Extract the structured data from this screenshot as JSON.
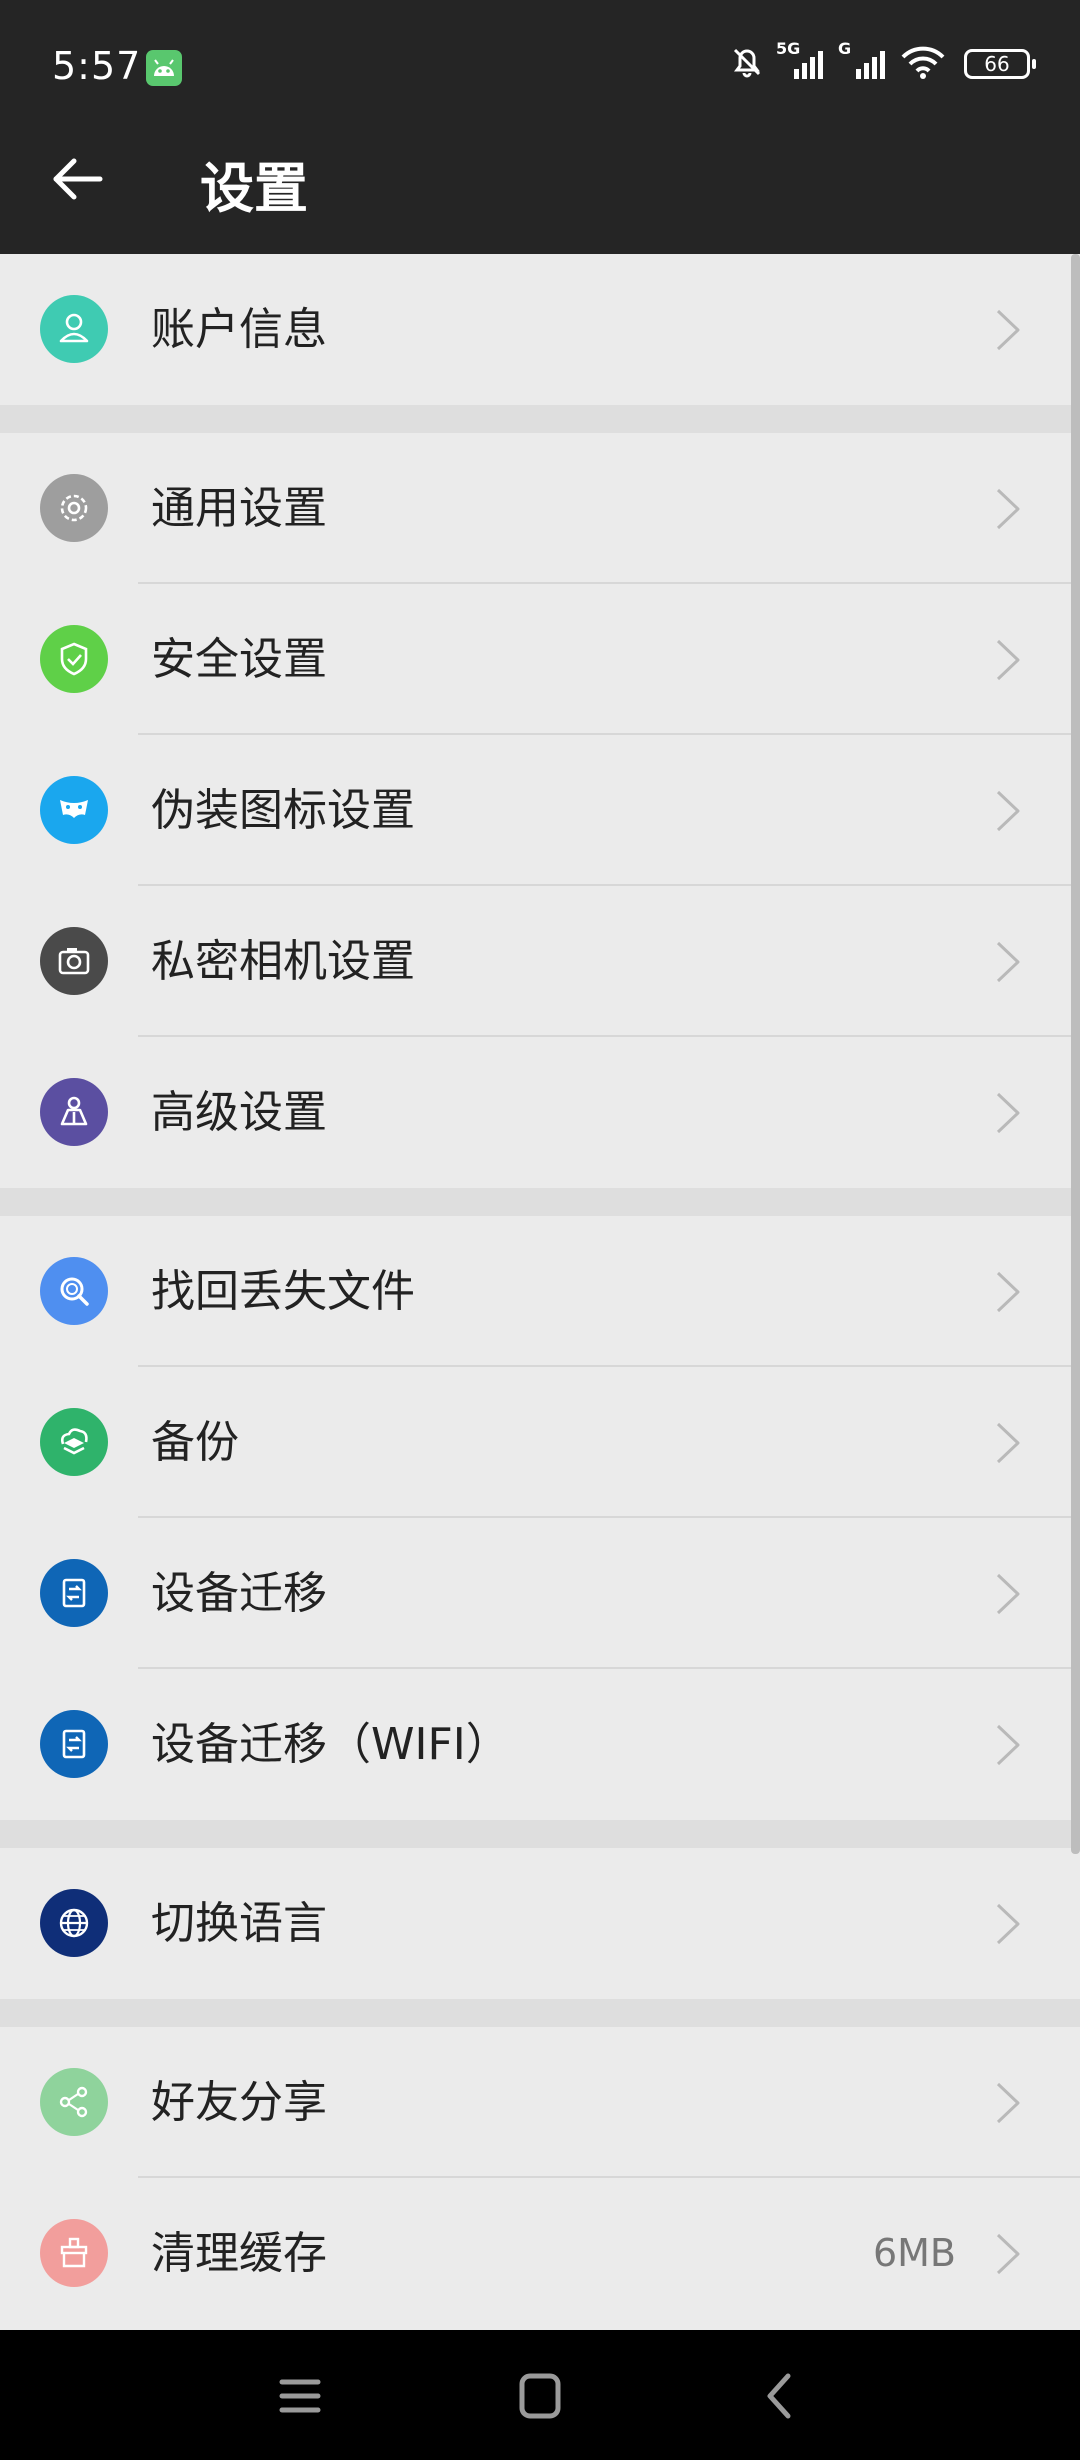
{
  "status_bar": {
    "time": "5:57",
    "app_icon": "android-icon",
    "icons": [
      "mute-bell-icon",
      "signal-5g-icon",
      "signal-g-icon",
      "wifi-icon"
    ],
    "signal1_label": "5G",
    "signal2_label": "G",
    "battery_level": "66"
  },
  "header": {
    "title": "设置",
    "back_icon": "back-arrow-icon"
  },
  "groups": [
    [
      {
        "label": "账户信息",
        "icon": "person-icon",
        "color": "#3fcbb2"
      }
    ],
    [
      {
        "label": "通用设置",
        "icon": "gear-icon",
        "color": "#9e9e9e"
      },
      {
        "label": "安全设置",
        "icon": "shield-check-icon",
        "color": "#5fd048"
      },
      {
        "label": "伪装图标设置",
        "icon": "mask-icon",
        "color": "#1aa7ee"
      },
      {
        "label": "私密相机设置",
        "icon": "camera-icon",
        "color": "#4a4a4a"
      },
      {
        "label": "高级设置",
        "icon": "advanced-user-icon",
        "color": "#5b4fa1"
      }
    ],
    [
      {
        "label": "找回丢失文件",
        "icon": "magnifier-icon",
        "color": "#4f8ff0"
      },
      {
        "label": "备份",
        "icon": "cloud-layers-icon",
        "color": "#2fb36b"
      },
      {
        "label": "设备迁移",
        "icon": "transfer-icon",
        "color": "#0f66b6"
      },
      {
        "label": "设备迁移（WIFI）",
        "icon": "transfer-wifi-icon",
        "color": "#0f66b6"
      }
    ],
    [
      {
        "label": "切换语言",
        "icon": "globe-icon",
        "color": "#0f2e78"
      }
    ],
    [
      {
        "label": "好友分享",
        "icon": "share-icon",
        "color": "#8fd39c"
      },
      {
        "label": "清理缓存",
        "icon": "broom-icon",
        "color": "#f29e9c",
        "value": "6MB"
      }
    ]
  ],
  "nav_bar": {
    "menu_icon": "menu-icon",
    "home_icon": "home-square-icon",
    "back_icon": "back-chevron-icon"
  },
  "colors": {
    "header_bg": "#252525",
    "list_bg": "#ebebeb",
    "separator": "#dedede",
    "chevron": "#b9b9b9"
  }
}
